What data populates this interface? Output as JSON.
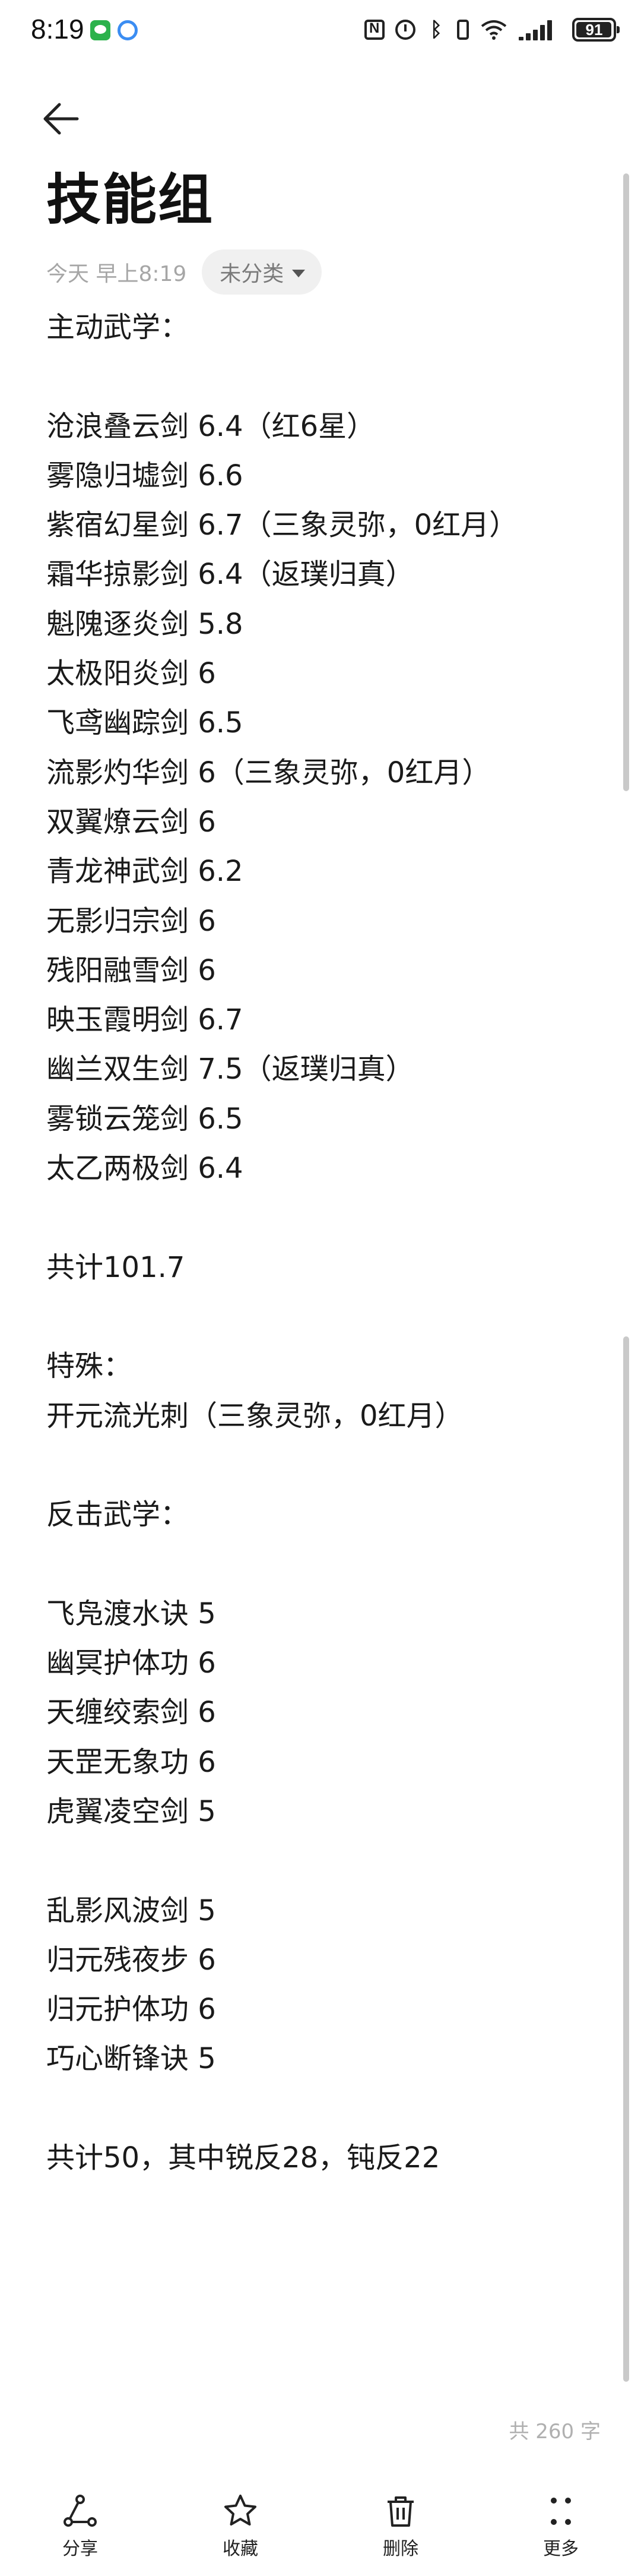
{
  "status_bar": {
    "time": "8:19",
    "battery": "91"
  },
  "header": {
    "title": "技能组",
    "date": "今天 早上8:19",
    "category": "未分类"
  },
  "note": {
    "lines": [
      "主动武学：",
      "",
      "沧浪叠云剑 6.4（红6星）",
      "雾隐归墟剑 6.6",
      "紫宿幻星剑 6.7（三象灵弥，0红月）",
      "霜华掠影剑 6.4（返璞归真）",
      "魁隗逐炎剑 5.8",
      "太极阳炎剑 6",
      "飞鸢幽踪剑 6.5",
      "流影灼华剑 6（三象灵弥，0红月）",
      "双翼燎云剑 6",
      "青龙神武剑 6.2",
      "无影归宗剑 6",
      "残阳融雪剑 6",
      "映玉霞明剑 6.7",
      "幽兰双生剑 7.5（返璞归真）",
      "雾锁云笼剑 6.5",
      "太乙两极剑 6.4",
      "",
      "共计101.7",
      "",
      "特殊：",
      "开元流光刺（三象灵弥，0红月）",
      "",
      "反击武学：",
      "",
      "飞凫渡水诀 5",
      "幽冥护体功 6",
      "天缠绞索剑 6",
      "天罡无象功 6",
      "虎翼凌空剑 5",
      "",
      "乱影风波剑 5",
      "归元残夜步 6",
      "归元护体功 6",
      "巧心断锋诀 5",
      "",
      "共计50，其中锐反28，钝反22"
    ],
    "word_count": "共 260 字"
  },
  "toolbar": {
    "share_label": "分享",
    "favorite_label": "收藏",
    "delete_label": "删除",
    "more_label": "更多"
  },
  "icons": {
    "back": "back-arrow-icon",
    "share": "share-icon",
    "favorite": "star-icon",
    "delete": "trash-icon",
    "more": "more-dots-icon",
    "category_dropdown": "chevron-down-icon"
  },
  "colors": {
    "background": "#ffffff",
    "text": "#1a1a1a",
    "meta_text": "#a6a6a6",
    "chip_bg": "#f0f0f0"
  }
}
